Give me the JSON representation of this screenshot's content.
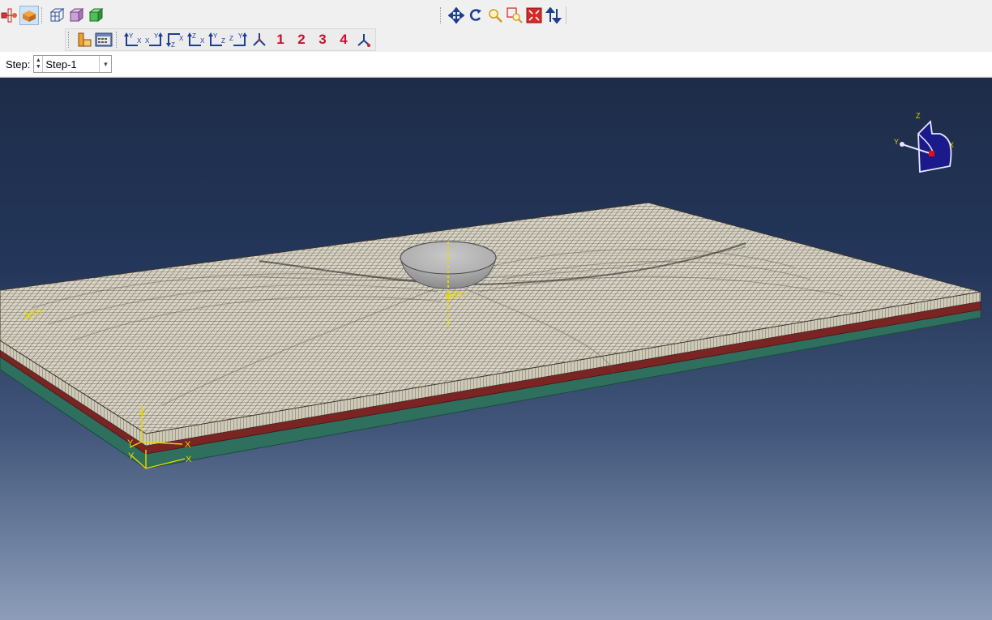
{
  "toolbar": {
    "row1_left_icons": [
      "model-tree-icon",
      "part-icon",
      "wireframe-icon",
      "hidden-line-icon",
      "shaded-icon"
    ],
    "row1_view_icons": [
      "pan-icon",
      "rotate-icon",
      "magnify-icon",
      "box-zoom-icon",
      "auto-fit-icon",
      "cycle-view-icon"
    ],
    "row2_icons": [
      "view-options-icon",
      "render-style-icon"
    ],
    "view_axes": [
      {
        "a": "Y",
        "b": "X"
      },
      {
        "a": "X",
        "b": "Y"
      },
      {
        "a": "Z",
        "b": "X"
      },
      {
        "a": "Z",
        "b": "X"
      },
      {
        "a": "Y",
        "b": "Z"
      },
      {
        "a": "Z",
        "b": "Y"
      }
    ],
    "view_numbers": [
      "1",
      "2",
      "3",
      "4"
    ]
  },
  "step": {
    "label": "Step:",
    "selected": "Step-1"
  },
  "viewport": {
    "rp_label_left": "RP",
    "rp_label_center": "RP",
    "csys_labels": {
      "y1": "Y",
      "x1": "X",
      "y2": "Y",
      "x2": "X",
      "z": "Z"
    },
    "triad": {
      "z": "Z",
      "y": "Y",
      "x": "X"
    },
    "colors": {
      "mesh_top": "#d6d2c4",
      "layer_red": "#7a2424",
      "layer_green": "#2f6f5e",
      "label_yellow": "#e8d800",
      "triad_blue": "#1a1a8a"
    }
  }
}
